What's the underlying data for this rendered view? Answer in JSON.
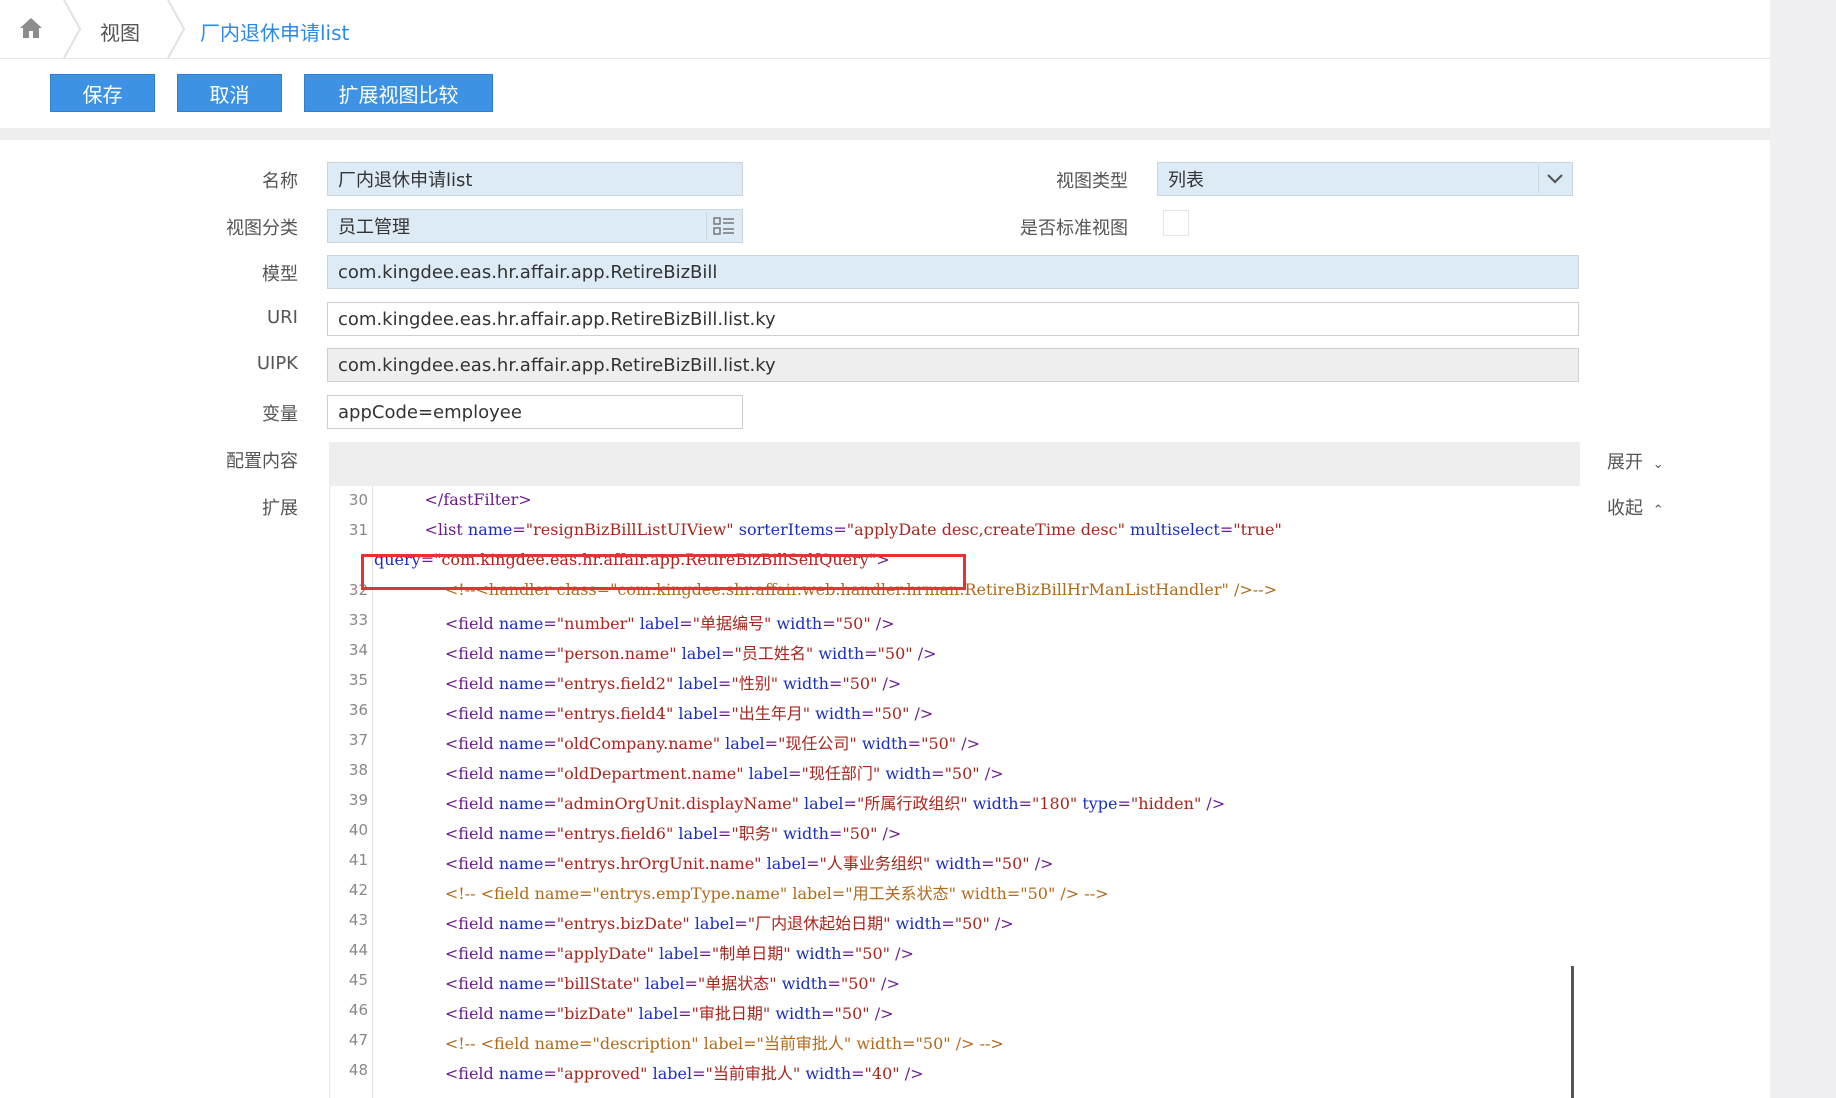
{
  "breadcrumb": {
    "item1": "视图",
    "item2": "厂内退休申请list"
  },
  "toolbar": {
    "save": "保存",
    "cancel": "取消",
    "compare": "扩展视图比较"
  },
  "form": {
    "name_label": "名称",
    "name_value": "厂内退休申请list",
    "viewtype_label": "视图类型",
    "viewtype_value": "列表",
    "category_label": "视图分类",
    "category_value": "员工管理",
    "standard_label": "是否标准视图",
    "model_label": "模型",
    "model_value": "com.kingdee.eas.hr.affair.app.RetireBizBill",
    "uri_label": "URI",
    "uri_value": "com.kingdee.eas.hr.affair.app.RetireBizBill.list.ky",
    "uipk_label": "UIPK",
    "uipk_value": "com.kingdee.eas.hr.affair.app.RetireBizBill.list.ky",
    "var_label": "变量",
    "var_value": "appCode=employee",
    "config_label": "配置内容",
    "expand_label": "扩展",
    "expand_link": "展开",
    "collapse_link": "收起"
  },
  "code": [
    {
      "num": "30",
      "indent": "      ",
      "parts": [
        {
          "c": "tag",
          "t": "</fastFilter>"
        }
      ]
    },
    {
      "num": "31",
      "indent": "      ",
      "parts": [
        {
          "c": "tag",
          "t": "<list "
        },
        {
          "c": "attr",
          "t": "name"
        },
        {
          "c": "tag",
          "t": "="
        },
        {
          "c": "val",
          "t": "\"resignBizBillListUIView\""
        },
        {
          "c": "attr",
          "t": " sorterItems"
        },
        {
          "c": "tag",
          "t": "="
        },
        {
          "c": "val",
          "t": "\"applyDate desc,createTime desc\""
        },
        {
          "c": "attr",
          "t": " multiselect"
        },
        {
          "c": "tag",
          "t": "="
        },
        {
          "c": "val",
          "t": "\"true\""
        }
      ]
    },
    {
      "num": "",
      "indent": "",
      "parts": [
        {
          "c": "attr",
          "t": "query"
        },
        {
          "c": "tag",
          "t": "="
        },
        {
          "c": "val",
          "t": "\"com.kingdee.eas.hr.affair.app.RetireBizBillSelfQuery\""
        },
        {
          "c": "tag",
          "t": ">"
        }
      ]
    },
    {
      "num": "32",
      "indent": "          ",
      "parts": [
        {
          "c": "cmt",
          "t": "<!--<handler class=\"com.kingdee.shr.affair.web.handler.hrman.RetireBizBillHrManListHandler\" />-->"
        }
      ]
    },
    {
      "num": "33",
      "indent": "          ",
      "parts": [
        {
          "c": "tag",
          "t": "<field "
        },
        {
          "c": "attr",
          "t": "name"
        },
        {
          "c": "tag",
          "t": "="
        },
        {
          "c": "val",
          "t": "\"number\""
        },
        {
          "c": "attr",
          "t": " label"
        },
        {
          "c": "tag",
          "t": "="
        },
        {
          "c": "val",
          "t": "\"单据编号\""
        },
        {
          "c": "attr",
          "t": " width"
        },
        {
          "c": "tag",
          "t": "="
        },
        {
          "c": "val",
          "t": "\"50\""
        },
        {
          "c": "tag",
          "t": " />"
        }
      ]
    },
    {
      "num": "34",
      "indent": "          ",
      "parts": [
        {
          "c": "tag",
          "t": "<field "
        },
        {
          "c": "attr",
          "t": "name"
        },
        {
          "c": "tag",
          "t": "="
        },
        {
          "c": "val",
          "t": "\"person.name\""
        },
        {
          "c": "attr",
          "t": " label"
        },
        {
          "c": "tag",
          "t": "="
        },
        {
          "c": "val",
          "t": "\"员工姓名\""
        },
        {
          "c": "attr",
          "t": " width"
        },
        {
          "c": "tag",
          "t": "="
        },
        {
          "c": "val",
          "t": "\"50\""
        },
        {
          "c": "tag",
          "t": " />"
        }
      ]
    },
    {
      "num": "35",
      "indent": "          ",
      "parts": [
        {
          "c": "tag",
          "t": "<field "
        },
        {
          "c": "attr",
          "t": "name"
        },
        {
          "c": "tag",
          "t": "="
        },
        {
          "c": "val",
          "t": "\"entrys.field2\""
        },
        {
          "c": "attr",
          "t": " label"
        },
        {
          "c": "tag",
          "t": "="
        },
        {
          "c": "val",
          "t": "\"性别\""
        },
        {
          "c": "attr",
          "t": " width"
        },
        {
          "c": "tag",
          "t": "="
        },
        {
          "c": "val",
          "t": "\"50\""
        },
        {
          "c": "tag",
          "t": " />"
        }
      ]
    },
    {
      "num": "36",
      "indent": "          ",
      "parts": [
        {
          "c": "tag",
          "t": "<field "
        },
        {
          "c": "attr",
          "t": "name"
        },
        {
          "c": "tag",
          "t": "="
        },
        {
          "c": "val",
          "t": "\"entrys.field4\""
        },
        {
          "c": "attr",
          "t": " label"
        },
        {
          "c": "tag",
          "t": "="
        },
        {
          "c": "val",
          "t": "\"出生年月\""
        },
        {
          "c": "attr",
          "t": " width"
        },
        {
          "c": "tag",
          "t": "="
        },
        {
          "c": "val",
          "t": "\"50\""
        },
        {
          "c": "tag",
          "t": " />"
        }
      ]
    },
    {
      "num": "37",
      "indent": "          ",
      "parts": [
        {
          "c": "tag",
          "t": "<field "
        },
        {
          "c": "attr",
          "t": "name"
        },
        {
          "c": "tag",
          "t": "="
        },
        {
          "c": "val",
          "t": "\"oldCompany.name\""
        },
        {
          "c": "attr",
          "t": " label"
        },
        {
          "c": "tag",
          "t": "="
        },
        {
          "c": "val",
          "t": "\"现任公司\""
        },
        {
          "c": "attr",
          "t": " width"
        },
        {
          "c": "tag",
          "t": "="
        },
        {
          "c": "val",
          "t": "\"50\""
        },
        {
          "c": "tag",
          "t": " />"
        }
      ]
    },
    {
      "num": "38",
      "indent": "          ",
      "parts": [
        {
          "c": "tag",
          "t": "<field "
        },
        {
          "c": "attr",
          "t": "name"
        },
        {
          "c": "tag",
          "t": "="
        },
        {
          "c": "val",
          "t": "\"oldDepartment.name\""
        },
        {
          "c": "attr",
          "t": " label"
        },
        {
          "c": "tag",
          "t": "="
        },
        {
          "c": "val",
          "t": "\"现任部门\""
        },
        {
          "c": "attr",
          "t": " width"
        },
        {
          "c": "tag",
          "t": "="
        },
        {
          "c": "val",
          "t": "\"50\""
        },
        {
          "c": "tag",
          "t": " />"
        }
      ]
    },
    {
      "num": "39",
      "indent": "          ",
      "parts": [
        {
          "c": "tag",
          "t": "<field "
        },
        {
          "c": "attr",
          "t": "name"
        },
        {
          "c": "tag",
          "t": "="
        },
        {
          "c": "val",
          "t": "\"adminOrgUnit.displayName\""
        },
        {
          "c": "attr",
          "t": " label"
        },
        {
          "c": "tag",
          "t": "="
        },
        {
          "c": "val",
          "t": "\"所属行政组织\""
        },
        {
          "c": "attr",
          "t": " width"
        },
        {
          "c": "tag",
          "t": "="
        },
        {
          "c": "val",
          "t": "\"180\""
        },
        {
          "c": "attr",
          "t": " type"
        },
        {
          "c": "tag",
          "t": "="
        },
        {
          "c": "val",
          "t": "\"hidden\""
        },
        {
          "c": "tag",
          "t": " />"
        }
      ]
    },
    {
      "num": "40",
      "indent": "          ",
      "parts": [
        {
          "c": "tag",
          "t": "<field "
        },
        {
          "c": "attr",
          "t": "name"
        },
        {
          "c": "tag",
          "t": "="
        },
        {
          "c": "val",
          "t": "\"entrys.field6\""
        },
        {
          "c": "attr",
          "t": " label"
        },
        {
          "c": "tag",
          "t": "="
        },
        {
          "c": "val",
          "t": "\"职务\""
        },
        {
          "c": "attr",
          "t": " width"
        },
        {
          "c": "tag",
          "t": "="
        },
        {
          "c": "val",
          "t": "\"50\""
        },
        {
          "c": "tag",
          "t": " />"
        }
      ]
    },
    {
      "num": "41",
      "indent": "          ",
      "parts": [
        {
          "c": "tag",
          "t": "<field "
        },
        {
          "c": "attr",
          "t": "name"
        },
        {
          "c": "tag",
          "t": "="
        },
        {
          "c": "val",
          "t": "\"entrys.hrOrgUnit.name\""
        },
        {
          "c": "attr",
          "t": " label"
        },
        {
          "c": "tag",
          "t": "="
        },
        {
          "c": "val",
          "t": "\"人事业务组织\""
        },
        {
          "c": "attr",
          "t": " width"
        },
        {
          "c": "tag",
          "t": "="
        },
        {
          "c": "val",
          "t": "\"50\""
        },
        {
          "c": "tag",
          "t": " />"
        }
      ]
    },
    {
      "num": "42",
      "indent": "          ",
      "parts": [
        {
          "c": "cmt",
          "t": "<!-- <field name=\"entrys.empType.name\" label=\"用工关系状态\" width=\"50\" /> -->"
        }
      ]
    },
    {
      "num": "43",
      "indent": "          ",
      "parts": [
        {
          "c": "tag",
          "t": "<field "
        },
        {
          "c": "attr",
          "t": "name"
        },
        {
          "c": "tag",
          "t": "="
        },
        {
          "c": "val",
          "t": "\"entrys.bizDate\""
        },
        {
          "c": "attr",
          "t": " label"
        },
        {
          "c": "tag",
          "t": "="
        },
        {
          "c": "val",
          "t": "\"厂内退休起始日期\""
        },
        {
          "c": "attr",
          "t": " width"
        },
        {
          "c": "tag",
          "t": "="
        },
        {
          "c": "val",
          "t": "\"50\""
        },
        {
          "c": "tag",
          "t": " />"
        }
      ]
    },
    {
      "num": "44",
      "indent": "          ",
      "parts": [
        {
          "c": "tag",
          "t": "<field "
        },
        {
          "c": "attr",
          "t": "name"
        },
        {
          "c": "tag",
          "t": "="
        },
        {
          "c": "val",
          "t": "\"applyDate\""
        },
        {
          "c": "attr",
          "t": " label"
        },
        {
          "c": "tag",
          "t": "="
        },
        {
          "c": "val",
          "t": "\"制单日期\""
        },
        {
          "c": "attr",
          "t": " width"
        },
        {
          "c": "tag",
          "t": "="
        },
        {
          "c": "val",
          "t": "\"50\""
        },
        {
          "c": "tag",
          "t": " />"
        }
      ]
    },
    {
      "num": "45",
      "indent": "          ",
      "parts": [
        {
          "c": "tag",
          "t": "<field "
        },
        {
          "c": "attr",
          "t": "name"
        },
        {
          "c": "tag",
          "t": "="
        },
        {
          "c": "val",
          "t": "\"billState\""
        },
        {
          "c": "attr",
          "t": " label"
        },
        {
          "c": "tag",
          "t": "="
        },
        {
          "c": "val",
          "t": "\"单据状态\""
        },
        {
          "c": "attr",
          "t": " width"
        },
        {
          "c": "tag",
          "t": "="
        },
        {
          "c": "val",
          "t": "\"50\""
        },
        {
          "c": "tag",
          "t": " />"
        }
      ]
    },
    {
      "num": "46",
      "indent": "          ",
      "parts": [
        {
          "c": "tag",
          "t": "<field "
        },
        {
          "c": "attr",
          "t": "name"
        },
        {
          "c": "tag",
          "t": "="
        },
        {
          "c": "val",
          "t": "\"bizDate\""
        },
        {
          "c": "attr",
          "t": " label"
        },
        {
          "c": "tag",
          "t": "="
        },
        {
          "c": "val",
          "t": "\"审批日期\""
        },
        {
          "c": "attr",
          "t": " width"
        },
        {
          "c": "tag",
          "t": "="
        },
        {
          "c": "val",
          "t": "\"50\""
        },
        {
          "c": "tag",
          "t": " />"
        }
      ]
    },
    {
      "num": "47",
      "indent": "          ",
      "parts": [
        {
          "c": "cmt",
          "t": "<!-- <field name=\"description\" label=\"当前审批人\" width=\"50\" /> -->"
        }
      ]
    },
    {
      "num": "48",
      "indent": "          ",
      "parts": [
        {
          "c": "tag",
          "t": "<field "
        },
        {
          "c": "attr",
          "t": "name"
        },
        {
          "c": "tag",
          "t": "="
        },
        {
          "c": "val",
          "t": "\"approved\""
        },
        {
          "c": "attr",
          "t": " label"
        },
        {
          "c": "tag",
          "t": "="
        },
        {
          "c": "val",
          "t": "\"当前审批人\""
        },
        {
          "c": "attr",
          "t": " width"
        },
        {
          "c": "tag",
          "t": "="
        },
        {
          "c": "val",
          "t": "\"40\""
        },
        {
          "c": "tag",
          "t": " />"
        }
      ]
    }
  ]
}
